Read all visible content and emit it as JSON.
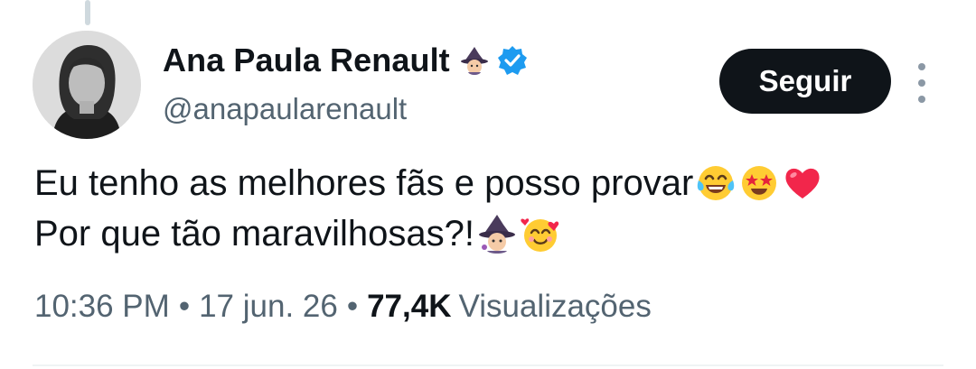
{
  "author": {
    "name": "Ana Paula Renault",
    "handle": "@anapaularenault",
    "name_emoji_icon": "witch-emoji-icon",
    "verified_icon": "verified-badge-icon"
  },
  "follow_button": {
    "label": "Seguir"
  },
  "tweet": {
    "lines": [
      "Eu tenho as melhores fãs e posso provar",
      "Por que tão maravilhosas?!"
    ],
    "line1_emoji_icons": [
      "tears-of-joy-emoji-icon",
      "star-struck-emoji-icon",
      "red-heart-emoji-icon"
    ],
    "line2_emoji_icons": [
      "witch-emoji-icon",
      "smiling-face-with-hearts-emoji-icon"
    ]
  },
  "meta": {
    "time": "10:36 PM",
    "separator": "•",
    "date": "17 jun. 26",
    "views_count": "77,4K",
    "views_label": "Visualizações"
  },
  "colors": {
    "text": "#0f1419",
    "secondary": "#536471",
    "verified": "#1d9bf0",
    "follow_bg": "#0f1419"
  }
}
